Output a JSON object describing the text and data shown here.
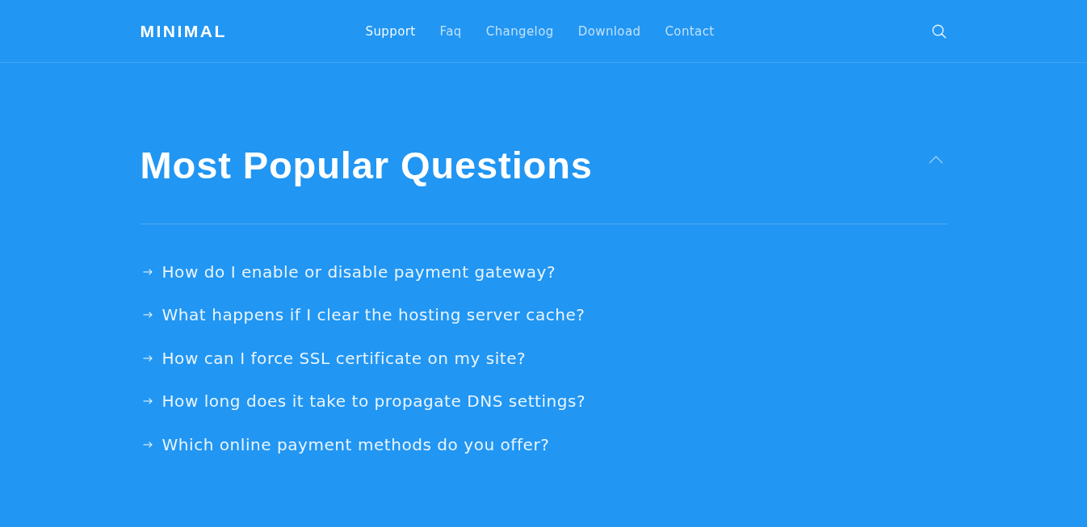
{
  "header": {
    "logo": "MINIMAL",
    "nav": [
      {
        "label": "Support",
        "selected": true
      },
      {
        "label": "Faq",
        "selected": false
      },
      {
        "label": "Changelog",
        "selected": false
      },
      {
        "label": "Download",
        "selected": false
      },
      {
        "label": "Contact",
        "selected": false
      }
    ]
  },
  "faq": {
    "title": "Most Popular Questions",
    "expanded": true,
    "questions": [
      "How do I enable or disable payment gateway?",
      "What happens if I clear the hosting server cache?",
      "How can I force SSL certificate on my site?",
      "How long does it take to propagate DNS settings?",
      "Which online payment methods do you offer?"
    ]
  }
}
